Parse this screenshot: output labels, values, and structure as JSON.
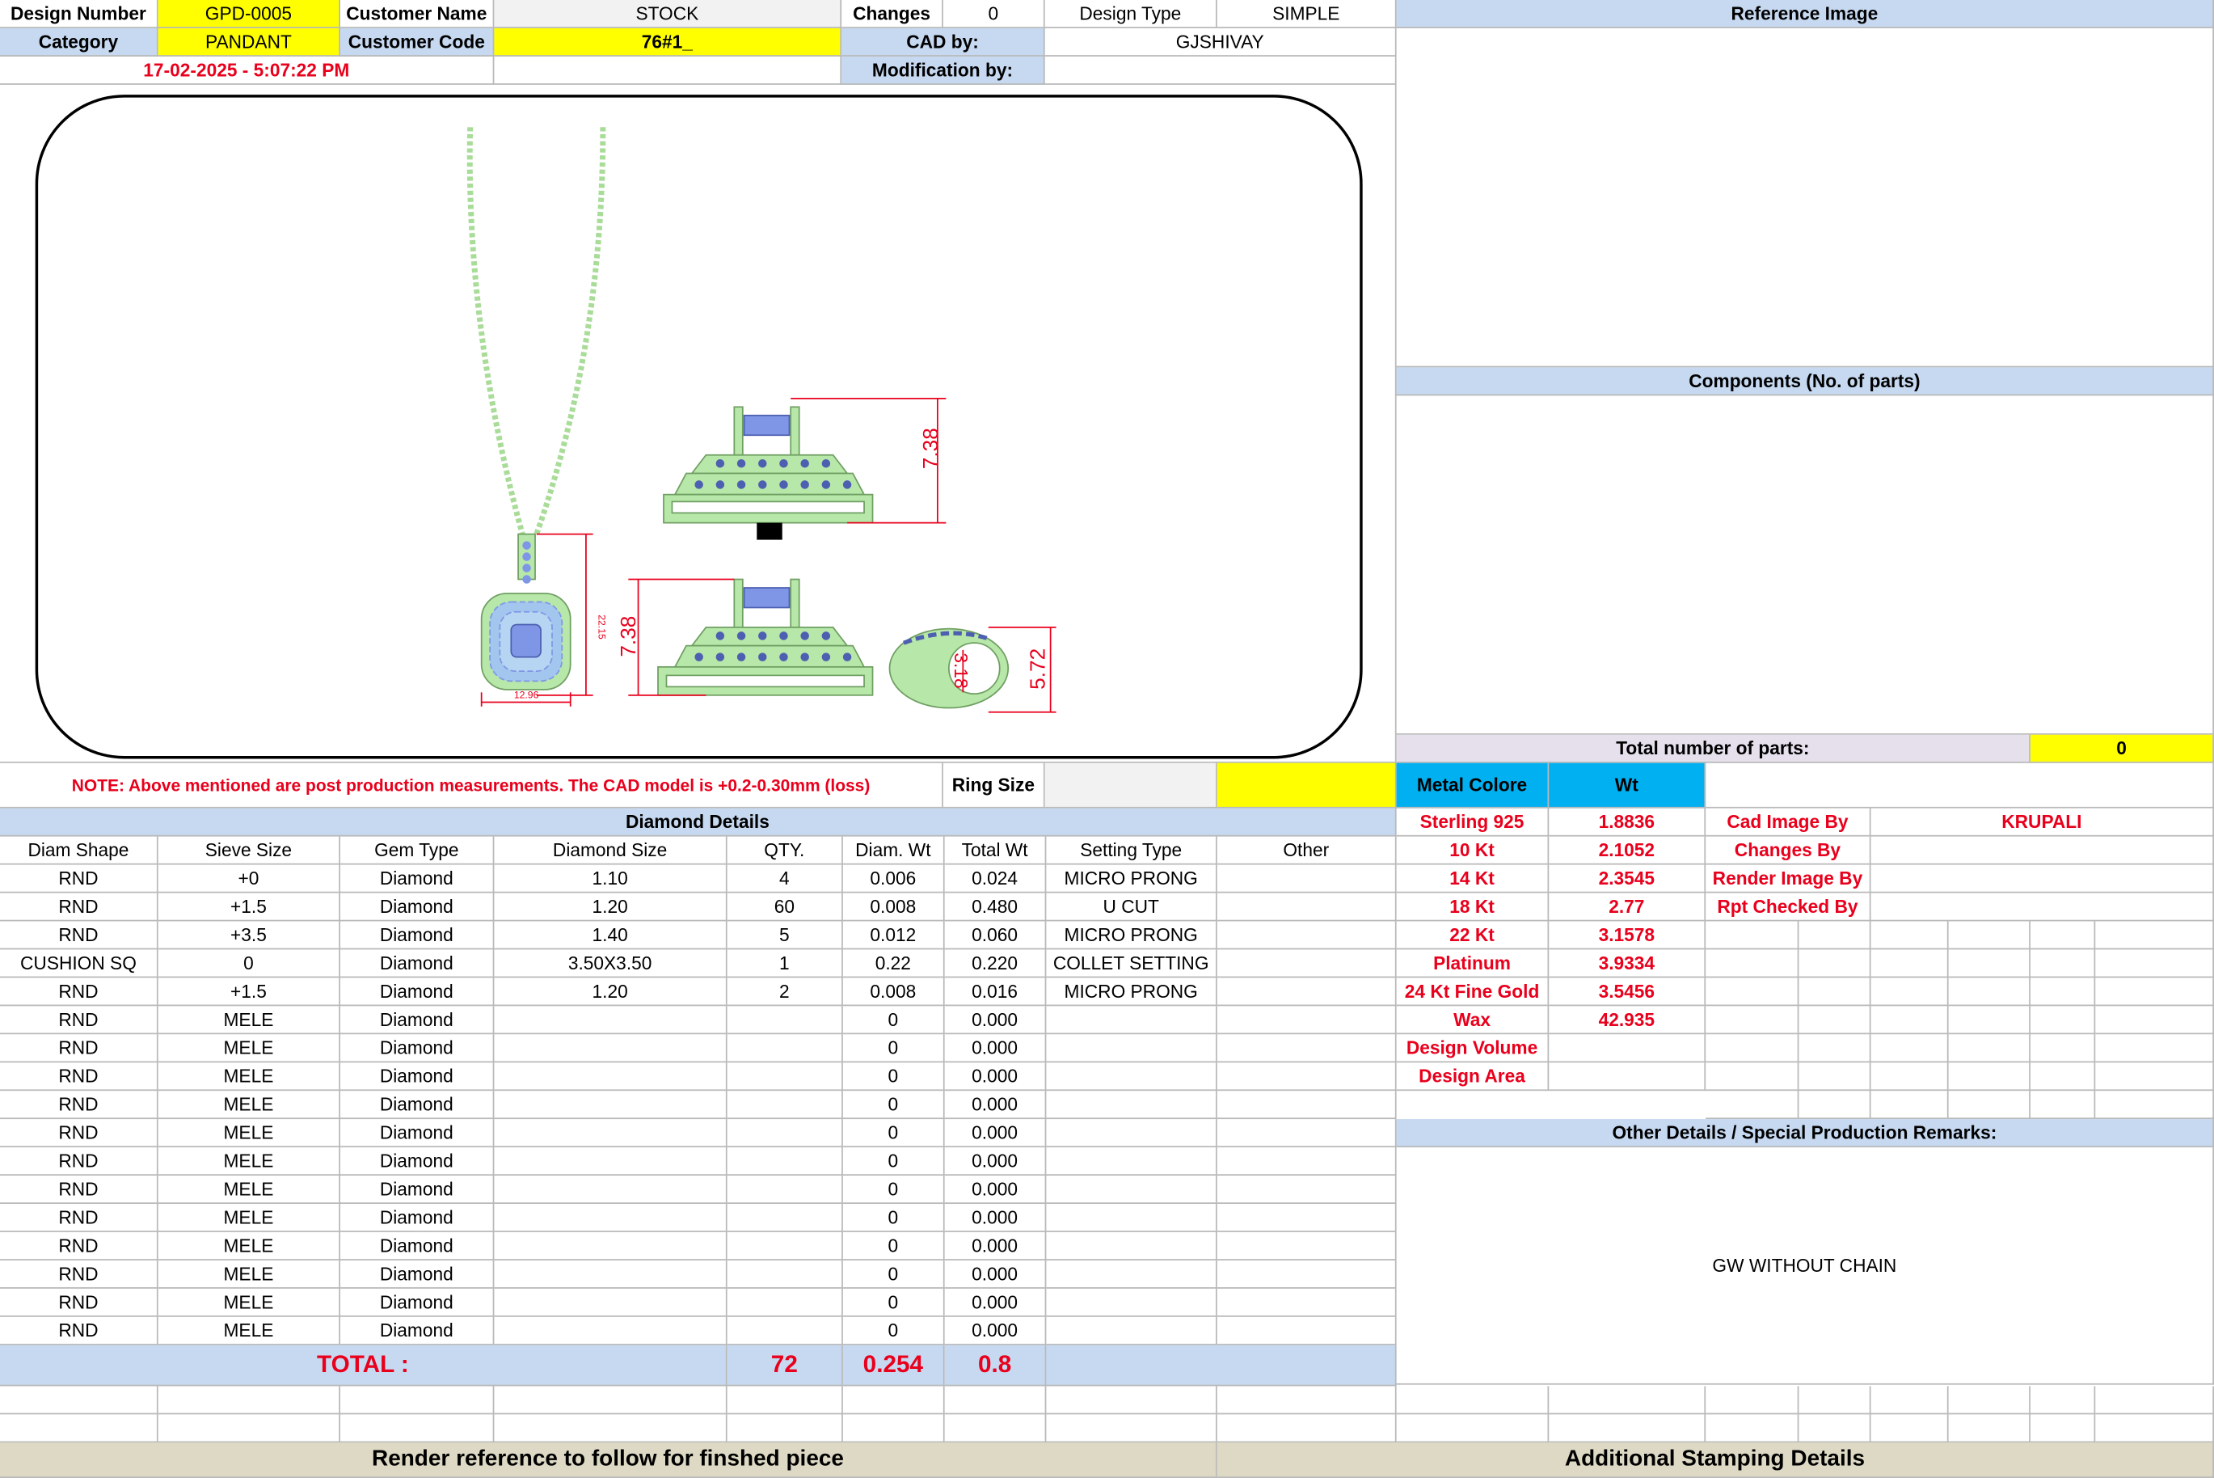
{
  "header": {
    "design_number_label": "Design Number",
    "design_number": "GPD-0005",
    "customer_name_label": "Customer Name",
    "customer_name": "STOCK",
    "changes_label": "Changes",
    "changes": "0",
    "design_type_label": "Design Type",
    "design_type": "SIMPLE",
    "reference_image_label": "Reference Image",
    "category_label": "Category",
    "category": "PANDANT",
    "customer_code_label": "Customer Code",
    "customer_code": "76#1_",
    "cad_by_label": "CAD by:",
    "cad_by": "GJSHIVAY",
    "timestamp": "17-02-2025 - 5:07:22 PM",
    "modification_by_label": "Modification by:",
    "modification_by": ""
  },
  "cad_view": {
    "front_width": "12.96",
    "front_height": "22.15",
    "side_top_height": "7.38",
    "side_bottom_height": "7.38",
    "bail_height": "5.72",
    "bail_inner": "3.18"
  },
  "components": {
    "title": "Components (No. of parts)",
    "total_label": "Total number of parts:",
    "total_value": "0"
  },
  "note": "NOTE: Above mentioned are post production measurements. The CAD model is +0.2-0.30mm (loss)",
  "ring_size_label": "Ring Size",
  "ring_size": "",
  "metal": {
    "header_label": "Metal Colore",
    "wt_label": "Wt",
    "rows": [
      {
        "name": "Sterling 925",
        "wt": "1.8836"
      },
      {
        "name": "10 Kt",
        "wt": "2.1052"
      },
      {
        "name": "14 Kt",
        "wt": "2.3545"
      },
      {
        "name": "18 Kt",
        "wt": "2.77"
      },
      {
        "name": "22 Kt",
        "wt": "3.1578"
      },
      {
        "name": "Platinum",
        "wt": "3.9334"
      },
      {
        "name": "24 Kt Fine Gold",
        "wt": "3.5456"
      },
      {
        "name": "Wax",
        "wt": "42.935"
      },
      {
        "name": "Design Volume",
        "wt": ""
      },
      {
        "name": "Design Area",
        "wt": ""
      }
    ]
  },
  "credits": {
    "cad_image_by_label": "Cad Image By",
    "cad_image_by": "KRUPALI",
    "changes_by_label": "Changes By",
    "render_image_by_label": "Render Image By",
    "rpt_checked_by_label": "Rpt Checked By"
  },
  "diamond": {
    "title": "Diamond Details",
    "columns": [
      "Diam Shape",
      "Sieve Size",
      "Gem Type",
      "Diamond Size",
      "QTY.",
      "Diam. Wt",
      "Total Wt",
      "Setting Type",
      "Other"
    ],
    "rows": [
      [
        "RND",
        "+0",
        "Diamond",
        "1.10",
        "4",
        "0.006",
        "0.024",
        "MICRO PRONG",
        ""
      ],
      [
        "RND",
        "+1.5",
        "Diamond",
        "1.20",
        "60",
        "0.008",
        "0.480",
        "U CUT",
        ""
      ],
      [
        "RND",
        "+3.5",
        "Diamond",
        "1.40",
        "5",
        "0.012",
        "0.060",
        "MICRO PRONG",
        ""
      ],
      [
        "CUSHION SQ",
        "0",
        "Diamond",
        "3.50X3.50",
        "1",
        "0.22",
        "0.220",
        "COLLET SETTING",
        ""
      ],
      [
        "RND",
        "+1.5",
        "Diamond",
        "1.20",
        "2",
        "0.008",
        "0.016",
        "MICRO PRONG",
        ""
      ],
      [
        "RND",
        "MELE",
        "Diamond",
        "",
        "",
        "0",
        "0.000",
        "",
        ""
      ],
      [
        "RND",
        "MELE",
        "Diamond",
        "",
        "",
        "0",
        "0.000",
        "",
        ""
      ],
      [
        "RND",
        "MELE",
        "Diamond",
        "",
        "",
        "0",
        "0.000",
        "",
        ""
      ],
      [
        "RND",
        "MELE",
        "Diamond",
        "",
        "",
        "0",
        "0.000",
        "",
        ""
      ],
      [
        "RND",
        "MELE",
        "Diamond",
        "",
        "",
        "0",
        "0.000",
        "",
        ""
      ],
      [
        "RND",
        "MELE",
        "Diamond",
        "",
        "",
        "0",
        "0.000",
        "",
        ""
      ],
      [
        "RND",
        "MELE",
        "Diamond",
        "",
        "",
        "0",
        "0.000",
        "",
        ""
      ],
      [
        "RND",
        "MELE",
        "Diamond",
        "",
        "",
        "0",
        "0.000",
        "",
        ""
      ],
      [
        "RND",
        "MELE",
        "Diamond",
        "",
        "",
        "0",
        "0.000",
        "",
        ""
      ],
      [
        "RND",
        "MELE",
        "Diamond",
        "",
        "",
        "0",
        "0.000",
        "",
        ""
      ],
      [
        "RND",
        "MELE",
        "Diamond",
        "",
        "",
        "0",
        "0.000",
        "",
        ""
      ],
      [
        "RND",
        "MELE",
        "Diamond",
        "",
        "",
        "0",
        "0.000",
        "",
        ""
      ]
    ],
    "total_label": "TOTAL :",
    "total_qty": "72",
    "total_diam_wt": "0.254",
    "total_wt": "0.8"
  },
  "remarks": {
    "title": "Other Details / Special Production Remarks:",
    "text": "GW WITHOUT CHAIN"
  },
  "footer": {
    "render_reference": "Render reference to follow for finshed piece",
    "stamping": "Additional Stamping Details"
  },
  "colors": {
    "header_blue": "#c6d9f1",
    "highlight_yellow": "#ffff00",
    "accent_red": "#e8001c",
    "metal_cyan": "#00b0f0",
    "footer_tan": "#ddd9c4",
    "cad_green": "#b7e7a9",
    "gem_blue": "#7f96e6"
  }
}
